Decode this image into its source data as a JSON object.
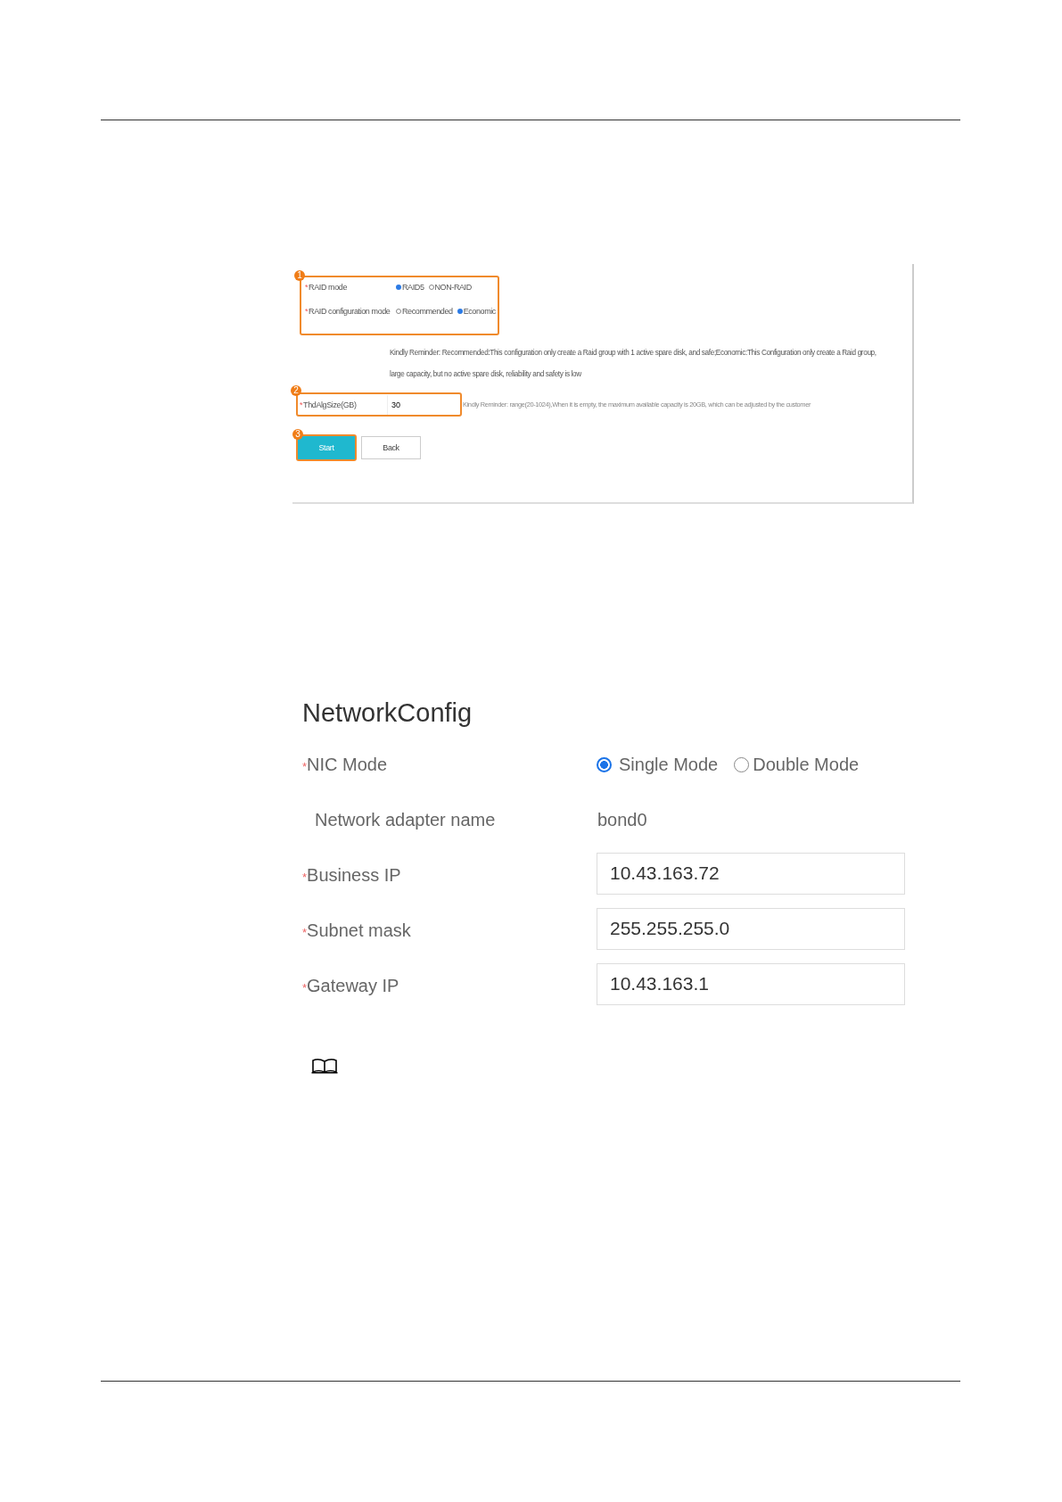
{
  "raid_panel": {
    "callouts": [
      "1",
      "2",
      "3"
    ],
    "rows": [
      {
        "mark": "*",
        "label": "RAID mode",
        "options": [
          {
            "label": "RAID5",
            "selected": true
          },
          {
            "label": "NON-RAID",
            "selected": false
          }
        ]
      },
      {
        "mark": "*",
        "label": "RAID configuration mode",
        "options": [
          {
            "label": "Recommended",
            "selected": false
          },
          {
            "label": "Economic",
            "selected": true
          }
        ]
      }
    ],
    "reminder": "Kindly Reminder:  Recommended:This configuration only create a Raid group with 1 active spare disk, and safe;Economic:This Configuration only create a Raid group, large capacity, but no active spare disk, reliability and safety is low",
    "size_field": {
      "mark": "*",
      "label": "ThdAlgSize(GB)",
      "value": "30",
      "reminder": "Kindly Reminder:  range(20-1024),When it is empty, the maximum available capacity is 20GB, which can be adjusted by the customer"
    },
    "buttons": [
      {
        "label": "Start",
        "kind": "primary"
      },
      {
        "label": "Back",
        "kind": "default"
      }
    ]
  },
  "network_config": {
    "title": "NetworkConfig",
    "nic_mode": {
      "mark": "*",
      "label": "NIC Mode",
      "options": [
        {
          "label": "Single Mode",
          "selected": true
        },
        {
          "label": "Double Mode",
          "selected": false
        }
      ]
    },
    "adapter": {
      "label": "Network adapter name",
      "value": "bond0"
    },
    "fields": [
      {
        "mark": "*",
        "label": "Business IP",
        "value": "10.43.163.72"
      },
      {
        "mark": "*",
        "label": "Subnet mask",
        "value": "255.255.255.0"
      },
      {
        "mark": "*",
        "label": "Gateway IP",
        "value": "10.43.163.1"
      }
    ]
  }
}
